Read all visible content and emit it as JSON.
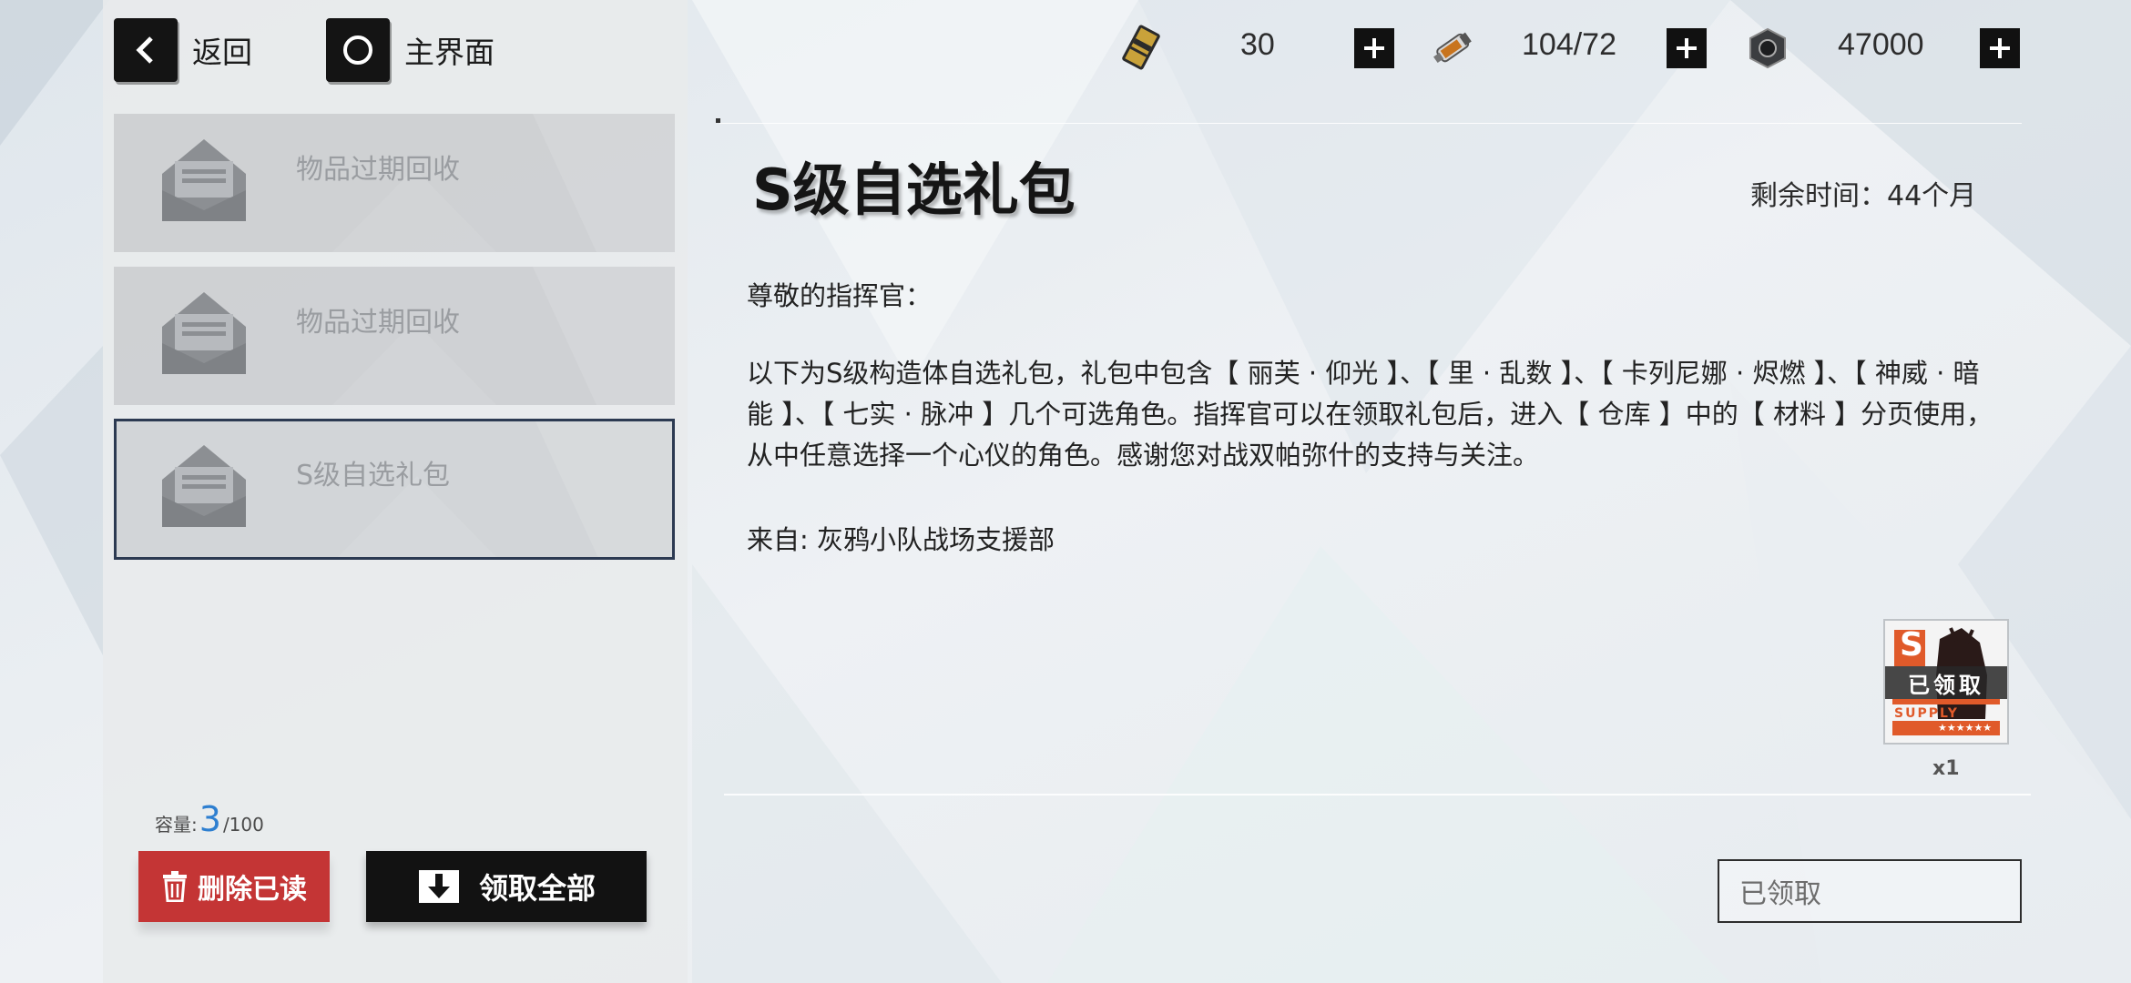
{
  "nav": {
    "back_label": "返回",
    "home_label": "主界面"
  },
  "currencies": [
    {
      "icon": "card-ticket-icon",
      "value": "30"
    },
    {
      "icon": "blood-vial-icon",
      "value": "104/72"
    },
    {
      "icon": "hex-coin-icon",
      "value": "47000"
    }
  ],
  "mail_list": [
    {
      "title": "物品过期回收",
      "selected": false
    },
    {
      "title": "物品过期回收",
      "selected": false
    },
    {
      "title": "S级自选礼包",
      "selected": true
    }
  ],
  "capacity": {
    "label": "容量:",
    "count": "3",
    "max": "/100"
  },
  "actions": {
    "delete_read": "删除已读",
    "claim_all": "领取全部"
  },
  "mail": {
    "title": "S级自选礼包",
    "remaining": "剩余时间：44个月",
    "greeting": "尊敬的指挥官：",
    "body": "以下为S级构造体自选礼包，礼包中包含【 丽芙 · 仰光 】、【 里 · 乱数 】、【 卡列尼娜 · 烬燃 】、【 神威 · 暗能 】、【 七实 · 脉冲 】几个可选角色。指挥官可以在领取礼包后，进入【 仓库 】中的【 材料 】分页使用，从中任意选择一个心仪的角色。感谢您对战双帕弥什的支持与关注。",
    "sender": "来自: 灰鸦小队战场支援部",
    "reward": {
      "badge_letter": "S",
      "brand": "SUPPLY",
      "stars": "★★★★★★",
      "claimed_label": "已领取",
      "count": "x1"
    },
    "status": "已领取"
  }
}
